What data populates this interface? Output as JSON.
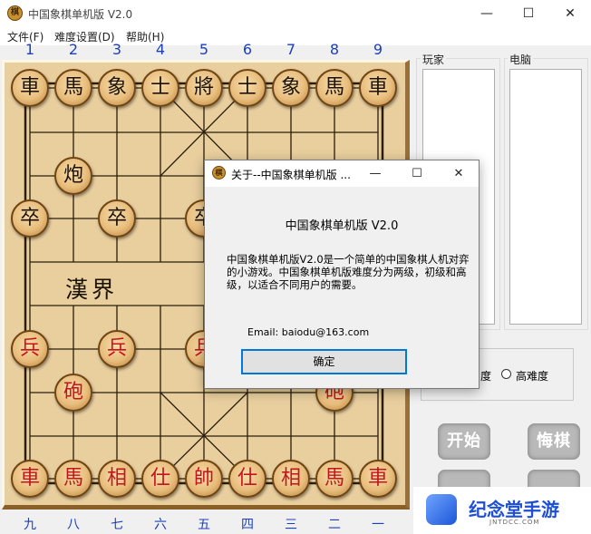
{
  "window": {
    "title": "中国象棋单机版 V2.0",
    "icon_text": "棋",
    "minimize": "—",
    "maximize": "☐",
    "close": "✕"
  },
  "menu": [
    "文件(F)",
    "难度设置(D)",
    "帮助(H)"
  ],
  "top_numbers": [
    "1",
    "2",
    "3",
    "4",
    "5",
    "6",
    "7",
    "8",
    "9"
  ],
  "bottom_numbers": [
    "九",
    "八",
    "七",
    "六",
    "五",
    "四",
    "三",
    "二",
    "一"
  ],
  "board": {
    "river_text": "漢界"
  },
  "pieces": {
    "black_back_row": [
      "車",
      "馬",
      "象",
      "士",
      "將",
      "士",
      "象",
      "馬",
      "車"
    ],
    "black_cannon": "炮",
    "black_soldier": "卒",
    "red_back_row": [
      "車",
      "馬",
      "相",
      "仕",
      "帥",
      "仕",
      "相",
      "馬",
      "車"
    ],
    "red_cannon": "砲",
    "red_soldier": "兵"
  },
  "panels": {
    "player_label": "玩家",
    "computer_label": "电脑",
    "difficulty_visible_fragment": "度",
    "difficulty_high_label": "高难度",
    "button_start": "开始",
    "button_undo": "悔棋"
  },
  "dialog": {
    "title": "关于--中国象棋单机版 ...",
    "icon_text": "棋",
    "minimize": "—",
    "maximize": "☐",
    "close": "✕",
    "app_title": "中国象棋单机版 V2.0",
    "description": "中国象棋单机版V2.0是一个简单的中国象棋人机对弈的小游戏。中国象棋单机版难度分为两级，初级和高级，以适合不同用户的需要。",
    "email": "Email:  baiodu@163.com",
    "ok_button": "确定"
  },
  "watermark": {
    "text": "纪念堂手游",
    "subtext": "JNTDCC.COM"
  },
  "colors": {
    "board": "#e9cf9e",
    "red_piece_text": "#c4151c",
    "black_piece_text": "#1c1207",
    "number_blue": "#1b3fbd",
    "dialog_accent": "#0078d7"
  }
}
